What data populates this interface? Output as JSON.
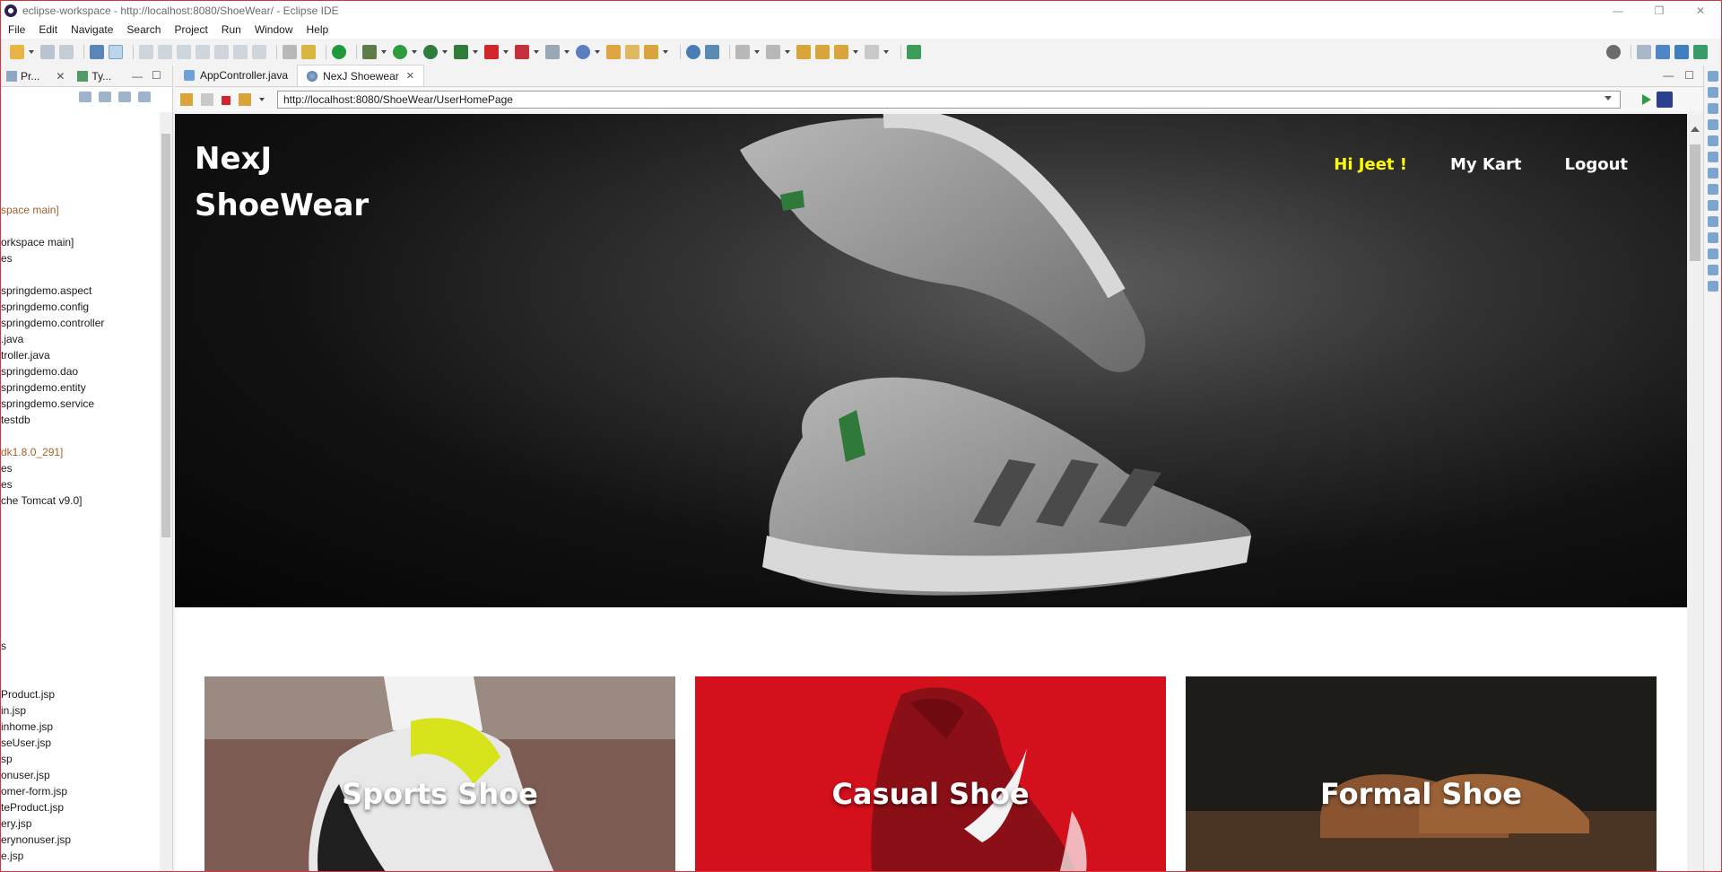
{
  "window": {
    "title": "eclipse-workspace - http://localhost:8080/ShoeWear/ - Eclipse IDE",
    "controls": [
      "—",
      "❐",
      "✕"
    ]
  },
  "menubar": {
    "items": [
      "File",
      "Edit",
      "Navigate",
      "Search",
      "Project",
      "Run",
      "Window",
      "Help"
    ]
  },
  "left_panel": {
    "tabs": [
      {
        "label": "Pr..."
      },
      {
        "label": "Ty..."
      }
    ],
    "tree": [
      {
        "text": "space main]",
        "style": "dec"
      },
      {
        "text": "",
        "style": ""
      },
      {
        "text": "orkspace main]",
        "style": "sel"
      },
      {
        "text": "es",
        "style": ""
      },
      {
        "text": "",
        "style": ""
      },
      {
        "text": "springdemo.aspect",
        "style": ""
      },
      {
        "text": "springdemo.config",
        "style": ""
      },
      {
        "text": "springdemo.controller",
        "style": ""
      },
      {
        "text": ".java",
        "style": ""
      },
      {
        "text": "troller.java",
        "style": ""
      },
      {
        "text": "springdemo.dao",
        "style": ""
      },
      {
        "text": "springdemo.entity",
        "style": ""
      },
      {
        "text": "springdemo.service",
        "style": ""
      },
      {
        "text": "testdb",
        "style": ""
      },
      {
        "text": "",
        "style": ""
      },
      {
        "text": "dk1.8.0_291]",
        "style": "dec"
      },
      {
        "text": "es",
        "style": ""
      },
      {
        "text": "es",
        "style": ""
      },
      {
        "text": "che Tomcat v9.0]",
        "style": ""
      },
      {
        "text": "",
        "style": ""
      },
      {
        "text": "",
        "style": ""
      },
      {
        "text": "",
        "style": ""
      },
      {
        "text": "",
        "style": ""
      },
      {
        "text": "",
        "style": ""
      },
      {
        "text": "",
        "style": ""
      },
      {
        "text": "",
        "style": ""
      },
      {
        "text": "",
        "style": ""
      },
      {
        "text": "s",
        "style": ""
      },
      {
        "text": "",
        "style": ""
      },
      {
        "text": "",
        "style": ""
      },
      {
        "text": "Product.jsp",
        "style": ""
      },
      {
        "text": "in.jsp",
        "style": ""
      },
      {
        "text": "inhome.jsp",
        "style": ""
      },
      {
        "text": "seUser.jsp",
        "style": ""
      },
      {
        "text": "sp",
        "style": ""
      },
      {
        "text": "onuser.jsp",
        "style": ""
      },
      {
        "text": "omer-form.jsp",
        "style": ""
      },
      {
        "text": "teProduct.jsp",
        "style": ""
      },
      {
        "text": "ery.jsp",
        "style": ""
      },
      {
        "text": "erynonuser.jsp",
        "style": ""
      },
      {
        "text": "e.jsp",
        "style": ""
      }
    ]
  },
  "editor": {
    "tabs": [
      {
        "label": "AppController.java",
        "active": false,
        "icon": "java-file-icon"
      },
      {
        "label": "NexJ Shoewear",
        "active": true,
        "icon": "globe-icon",
        "close": "✕"
      }
    ]
  },
  "browser": {
    "url": "http://localhost:8080/ShoeWear/UserHomePage"
  },
  "page": {
    "brand": {
      "line1": "NexJ",
      "line2": "ShoeWear"
    },
    "nav": {
      "greeting": "Hi Jeet !",
      "cart": "My Kart",
      "logout": "Logout"
    },
    "cards": [
      {
        "title": "Sports Shoe",
        "bg": "#6b6560"
      },
      {
        "title": "Casual Shoe",
        "bg": "#d0101c"
      },
      {
        "title": "Formal Shoe",
        "bg": "#1c1a17"
      }
    ]
  },
  "colors": {
    "greeting": "#ffff00",
    "window_border": "#d9343b",
    "selection": "#cde3f7"
  }
}
